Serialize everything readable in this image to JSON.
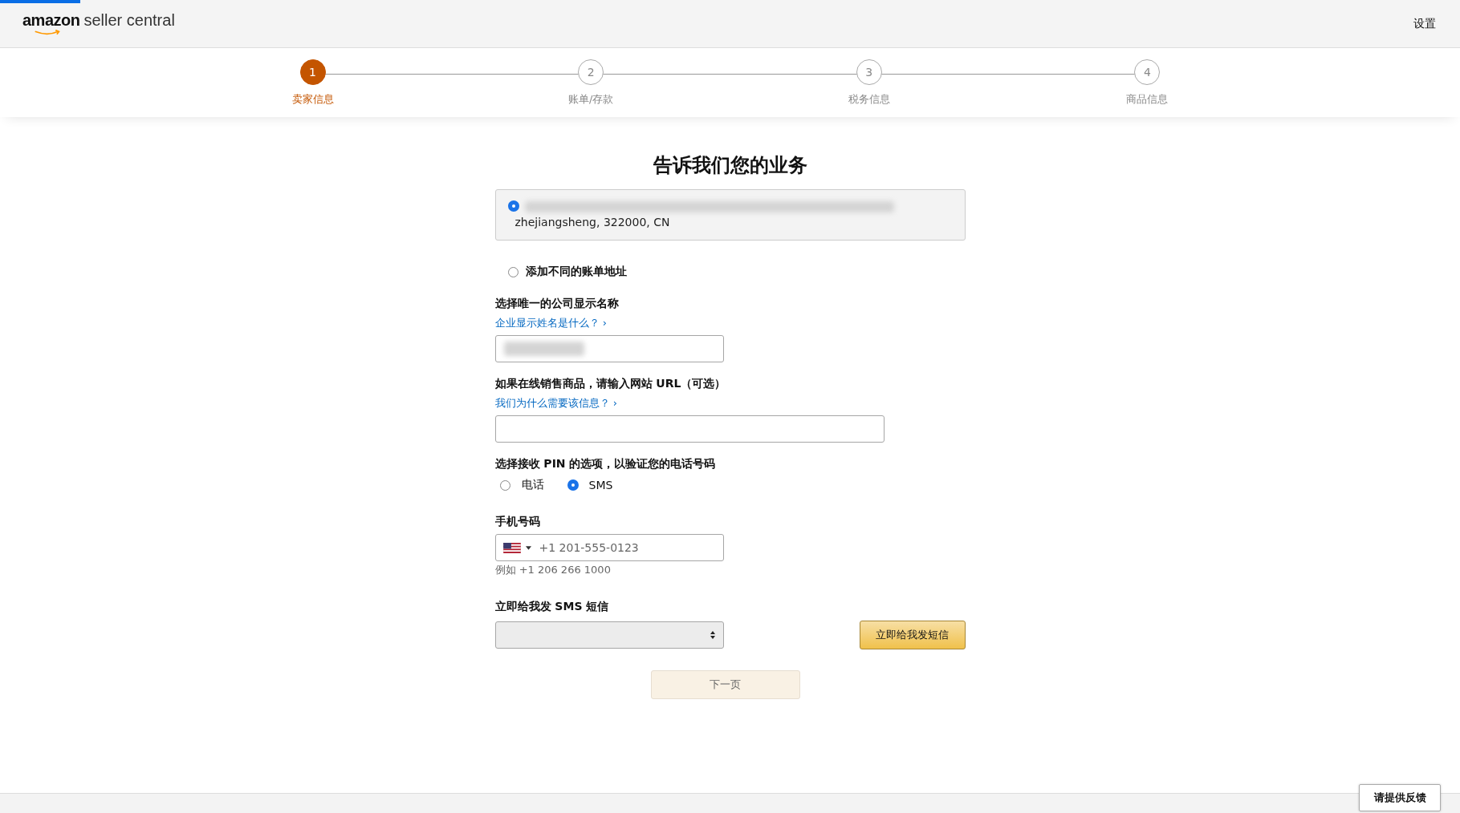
{
  "header": {
    "logo": {
      "brand": "amazon",
      "product": "seller central"
    },
    "settings_link": "设置"
  },
  "steps": [
    {
      "number": "1",
      "label": "卖家信息",
      "selected": true
    },
    {
      "number": "2",
      "label": "账单/存款",
      "selected": false
    },
    {
      "number": "3",
      "label": "税务信息",
      "selected": false
    },
    {
      "number": "4",
      "label": "商品信息",
      "selected": false
    }
  ],
  "title": "告诉我们您的业务",
  "address_options": [
    {
      "kind": "address",
      "line_1_redacted": true,
      "line_2": "zhejiangsheng, 322000, CN",
      "selected": true
    },
    {
      "kind": "add",
      "label": "添加不同的账单地址",
      "selected": false
    }
  ],
  "display_name": {
    "label": "选择唯一的公司显示名称",
    "help_link": "企业显示姓名是什么？ ›",
    "value_redacted": true
  },
  "website": {
    "label": "如果在线销售商品，请输入网站 URL（可选）",
    "help_link": "我们为什么需要该信息？ ›"
  },
  "pin": {
    "label": "选择接收 PIN 的选项，以验证您的电话号码",
    "options": [
      {
        "label": "电话",
        "selected": false
      },
      {
        "label": "SMS",
        "selected": true
      }
    ]
  },
  "phone": {
    "label": "手机号码",
    "placeholder": "+1 201-555-0123",
    "hint": "例如 +1 206 266 1000"
  },
  "sms": {
    "label": "立即给我发 SMS 短信",
    "button": "立即给我发短信"
  },
  "next_button": {
    "label": "下一页",
    "disabled": true
  },
  "feedback_button": "请提供反馈"
}
